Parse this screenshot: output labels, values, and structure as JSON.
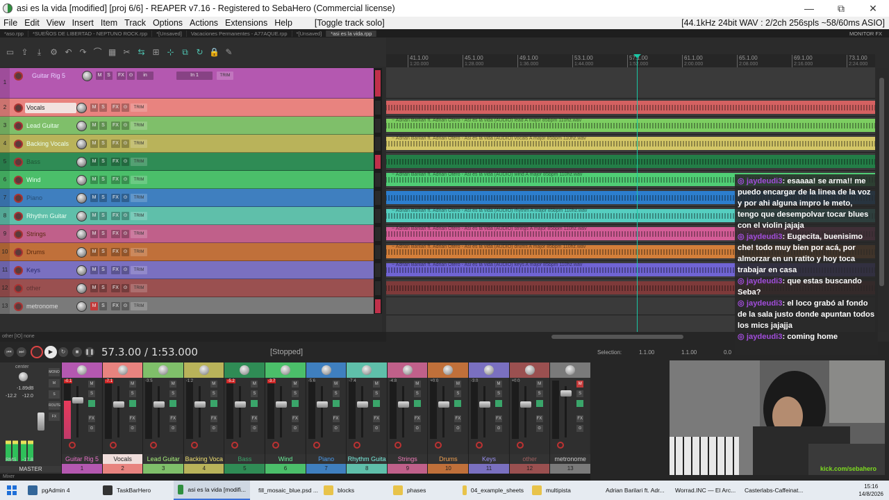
{
  "window": {
    "title": "asi es la vida [modified] [proj 6/6] - REAPER v7.16 - Registered to SebaHero (Commercial license)",
    "minimize": "—",
    "maximize": "⧉",
    "close": "✕"
  },
  "menu": {
    "items": [
      "File",
      "Edit",
      "View",
      "Insert",
      "Item",
      "Track",
      "Options",
      "Actions",
      "Extensions",
      "Help"
    ],
    "toggle": "[Toggle track solo]",
    "audio_info": "[44.1kHz 24bit WAV : 2/2ch 256spls ~58/60ms ASIO]"
  },
  "project_tabs": [
    "*aso.rpp",
    "*SUEÑOS DE LIBERTAD - NEPTUNO ROCK.rpp",
    "*[Unsaved]",
    "Vacaciones Permanentes - A77AQUE.rpp",
    "*[Unsaved]",
    "*asi es la vida.rpp"
  ],
  "monitor_fx": "MONITOR FX",
  "ruler": [
    {
      "bar": "41.1.00",
      "time": "1:20.000"
    },
    {
      "bar": "45.1.00",
      "time": "1:28.000"
    },
    {
      "bar": "49.1.00",
      "time": "1:36.000"
    },
    {
      "bar": "53.1.00",
      "time": "1:44.000"
    },
    {
      "bar": "57.1.00",
      "time": "1:52.000"
    },
    {
      "bar": "61.1.00",
      "time": "2:00.000"
    },
    {
      "bar": "65.1.00",
      "time": "2:08.000"
    },
    {
      "bar": "69.1.00",
      "time": "2:16.000"
    },
    {
      "bar": "73.1.00",
      "time": "2:24.000"
    }
  ],
  "tracks": [
    {
      "num": "1",
      "name": "Guitar Rig 5",
      "color": "#b458b0",
      "lane_color": "#555555",
      "fx": "FX",
      "in_label": "in",
      "input": "In 1",
      "trim": "TRIM",
      "item": ""
    },
    {
      "num": "2",
      "name": "Vocals",
      "color": "#e8837f",
      "lane_color": "#f06868",
      "trim": "TRIM",
      "item": ""
    },
    {
      "num": "3",
      "name": "Lead Guitar",
      "color": "#7fbf6a",
      "lane_color": "#88e868",
      "trim": "TRIM",
      "item": "~ Adrian Barilari ft. Adrian Otero - Asi es la vida (AUDIO) lead A major 85bpm 110hz.wav"
    },
    {
      "num": "4",
      "name": "Backing Vocals",
      "color": "#b9b35a",
      "lane_color": "#f0e070",
      "trim": "TRIM",
      "item": "~ Adrian Barilari ft. Adrian Otero - Asi es la vida (AUDIO) vocals A major 85bpm 110hz.wav"
    },
    {
      "num": "5",
      "name": "Bass",
      "color": "#2f8c55",
      "lane_color": "#1f8a4a",
      "trim": "TRIM",
      "item": ""
    },
    {
      "num": "6",
      "name": "Wind",
      "color": "#4bbf6a",
      "lane_color": "#55e880",
      "trim": "TRIM",
      "item": "~ Adrian Barilari ft. Adrian Otero - Asi es la vida (AUDIO) wind A major 85bpm 110hz.wav"
    },
    {
      "num": "7",
      "name": "Piano",
      "color": "#3f7fbf",
      "lane_color": "#2a8be8",
      "trim": "TRIM",
      "item": ""
    },
    {
      "num": "8",
      "name": "Rhythm Guitar",
      "color": "#5fbfaa",
      "lane_color": "#5ae8d8",
      "trim": "TRIM",
      "item": "~ Adrian Barilari ft. Adrian Otero - Asi es la vida (AUDIO) rhythm A major 85bpm 110hz.wav"
    },
    {
      "num": "9",
      "name": "Strings",
      "color": "#c0608a",
      "lane_color": "#f064a8",
      "trim": "TRIM",
      "item": "~ Adrian Barilari ft. Adrian Otero - Asi es la vida (AUDIO) strings A major 85bpm 110hz.wav"
    },
    {
      "num": "10",
      "name": "Drums",
      "color": "#c0703a",
      "lane_color": "#f08c3a",
      "trim": "TRIM",
      "item": "~ Adrian Barilari ft. Adrian Otero - Asi es la vida (AUDIO) drums A major 85bpm 110hz.wav"
    },
    {
      "num": "11",
      "name": "Keys",
      "color": "#7a70c0",
      "lane_color": "#7a6cf0",
      "trim": "TRIM",
      "item": "~ Adrian Barilari ft. Adrian Otero - Asi es la vida (AUDIO) keys A major 85bpm 110hz.wav"
    },
    {
      "num": "12",
      "name": "other",
      "color": "#9a5050",
      "lane_color": "#8a3a3a",
      "trim": "TRIM",
      "item": ""
    },
    {
      "num": "13",
      "name": "metronome",
      "color": "#7a7a7a",
      "lane_color": "#4a4a4a",
      "trim": "TRIM",
      "item": ""
    }
  ],
  "track_buttons": {
    "mute": "M",
    "solo": "S",
    "fx": "FX",
    "phase": "⊙"
  },
  "status_strip": "other [IO] none",
  "transport": {
    "time": "57.3.00 / 1:53.000",
    "state": "[Stopped]",
    "selection_label": "Selection:",
    "sel_start": "1.1.00",
    "sel_end": "1.1.00",
    "sel_len": "0.0"
  },
  "master": {
    "label": "MASTER",
    "pan": "center",
    "volume": "-1.89dB",
    "peak_l": "-12.2",
    "peak_r": "-12.0",
    "rms_label": "RMS",
    "rms_value": "-17.8",
    "buttons": [
      "MONO",
      "M",
      "S",
      "ROUTE",
      "FX"
    ],
    "level": 0.55
  },
  "mixer_strips": [
    {
      "label": "Guitar Rig 5",
      "num": "1",
      "peak": "-0.1",
      "clip": true,
      "color": "#b458b0",
      "label_color": "#e870c8",
      "level": 0.65
    },
    {
      "label": "Vocals",
      "num": "2",
      "peak": "-7.1",
      "clip": true,
      "color": "#e8837f",
      "label_color": "#222222",
      "level": 0.0
    },
    {
      "label": "Lead Guitar",
      "num": "3",
      "peak": "-3.5",
      "clip": false,
      "color": "#7fbf6a",
      "label_color": "#a6f07a",
      "level": 0.0
    },
    {
      "label": "Backing Voca",
      "num": "4",
      "peak": "-1.2",
      "clip": false,
      "color": "#b9b35a",
      "label_color": "#f0e070",
      "level": 0.0
    },
    {
      "label": "Bass",
      "num": "5",
      "peak": "-5.2",
      "clip": true,
      "color": "#2f8c55",
      "label_color": "#3aa56a",
      "level": 0.0
    },
    {
      "label": "Wind",
      "num": "6",
      "peak": "-3.7",
      "clip": true,
      "color": "#4bbf6a",
      "label_color": "#6af09a",
      "level": 0.0
    },
    {
      "label": "Piano",
      "num": "7",
      "peak": "-5.6",
      "clip": false,
      "color": "#3f7fbf",
      "label_color": "#4a9cf0",
      "level": 0.0
    },
    {
      "label": "Rhythm Guita",
      "num": "8",
      "peak": "-7.4",
      "clip": false,
      "color": "#5fbfaa",
      "label_color": "#7af0e0",
      "level": 0.0
    },
    {
      "label": "Strings",
      "num": "9",
      "peak": "-4.8",
      "clip": false,
      "color": "#c0608a",
      "label_color": "#f07ab8",
      "level": 0.0
    },
    {
      "label": "Drums",
      "num": "10",
      "peak": "+0.0",
      "clip": false,
      "color": "#c0703a",
      "label_color": "#f0a050",
      "level": 0.0
    },
    {
      "label": "Keys",
      "num": "11",
      "peak": "-3.0",
      "clip": false,
      "color": "#7a70c0",
      "label_color": "#9a90f0",
      "level": 0.0
    },
    {
      "label": "other",
      "num": "12",
      "peak": "+0.0",
      "clip": false,
      "color": "#9a5050",
      "label_color": "#a06060",
      "level": 0.0
    },
    {
      "label": "metronome",
      "num": "13",
      "peak": "",
      "clip": false,
      "color": "#7a7a7a",
      "label_color": "#cccccc",
      "level": 0.0
    }
  ],
  "mixer_tab": "Mixer",
  "chat": [
    {
      "user": "jaydeudi3",
      "text": ": esaaaa! se arma!! me puedo encargar de la linea de la voz y por ahi alguna impro le meto, tengo que desempolvar tocar blues con el violin jajaja"
    },
    {
      "user": "jaydeudi3",
      "text": ": Eugecita, buenisimo che! todo muy bien por acá, por almorzar en un ratito y hoy toca trabajar en casa"
    },
    {
      "user": "jaydeudi3",
      "text": ": que estas buscando Seba?"
    },
    {
      "user": "jaydeudi3",
      "text": ": el loco grabó al fondo de la sala justo donde apuntan todos los mics jajajja"
    },
    {
      "user": "jaydeudi3",
      "text": ": coming home"
    }
  ],
  "webcam": {
    "link": "kick.com/sebahero"
  },
  "taskbar": {
    "tasks": [
      {
        "label": "pgAdmin 4",
        "icon_color": "#336699",
        "active": false
      },
      {
        "label": "TaskBarHero",
        "icon_color": "#333333",
        "active": false
      },
      {
        "label": "asi es la vida [modifi...",
        "icon_color": "#2f8f3f",
        "active": true
      },
      {
        "label": "fill_mosaic_blue.psd ...",
        "icon_color": "#0a2a5a",
        "active": false
      },
      {
        "label": "blocks",
        "icon_color": "#e8c34a",
        "active": false
      },
      {
        "label": "phases",
        "icon_color": "#e8c34a",
        "active": false
      },
      {
        "label": "04_example_sheets",
        "icon_color": "#e8c34a",
        "active": false
      },
      {
        "label": "multipista",
        "icon_color": "#e8c34a",
        "active": false
      },
      {
        "label": "Adrian Barilari ft. Adr...",
        "icon_color": "#d9342b",
        "active": false
      },
      {
        "label": "Worrad.INC — El Arc...",
        "icon_color": "#4285f4",
        "active": false
      },
      {
        "label": "Casterlabs-Caffeinat...",
        "icon_color": "#d9342b",
        "active": false
      }
    ],
    "time": "15:16",
    "date": "14/8/2026"
  }
}
